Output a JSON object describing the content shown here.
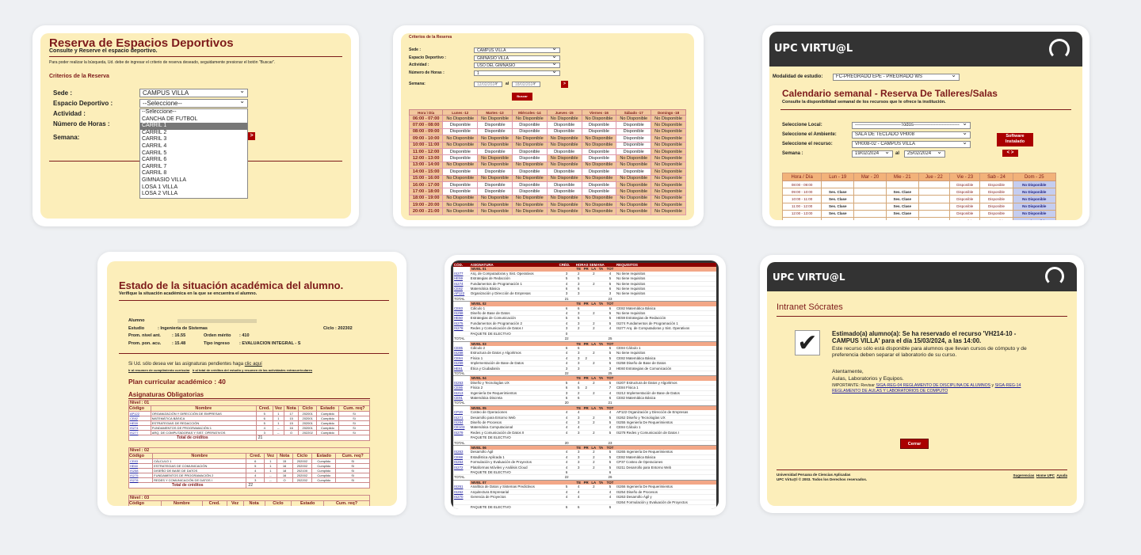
{
  "c1": {
    "title": "Reserva de Espacios Deportivos",
    "subtitle": "Consulte y Reserve el espacio deportivo.",
    "help": "Para poder realizar la búsqueda, Ud. debe de ingresar el criterio de reserva deseado, seguidamente presionar el botón \"Buscar\".",
    "section": "Criterios de la Reserva",
    "l_sede": "Sede :",
    "v_sede": "CAMPUS VILLA",
    "l_esp": "Espacio Deportivo :",
    "v_esp": "--Seleccione--",
    "l_act": "Actividad :",
    "l_horas": "Número de Horas :",
    "l_sem": "Semana:",
    "options": [
      "--Seleccione--",
      "CANCHA DE FUTBOL",
      "CARRIL 1",
      "CARRIL 2",
      "CARRIL 3",
      "CARRIL 4",
      "CARRIL 5",
      "CARRIL 6",
      "CARRIL 7",
      "CARRIL 8",
      "GIMNASIO VILLA",
      "LOSA 1 VILLA",
      "LOSA 2 VILLA"
    ],
    "selected": "CARRIL 1"
  },
  "c2": {
    "section": "Criterios de la Reserva",
    "l_sede": "Sede :",
    "v_sede": "CAMPUS VILLA",
    "l_esp": "Espacio Deportivo :",
    "v_esp": "GIMNASIO VILLA",
    "l_act": "Actividad :",
    "v_act": "USO DEL GIMNASIO",
    "l_horas": "Número de Horas :",
    "v_horas": "1",
    "l_sem": "Semana:",
    "from": "12/02/2024",
    "al": "al",
    "to": "18/02/2024",
    "search": "Buscar",
    "go": ">",
    "headers": [
      "Hora \\ Día",
      "Lunes -12",
      "Martes -13",
      "Miércoles -14",
      "Jueves -15",
      "Viernes -16",
      "Sábado -17",
      "Domingo -18"
    ],
    "rows": [
      [
        "06:00 - 07:00",
        "No Disponible",
        "No Disponible",
        "No Disponible",
        "No Disponible",
        "No Disponible",
        "No Disponible",
        "No Disponible"
      ],
      [
        "07:00 - 08:00",
        "Disponible",
        "Disponible",
        "Disponible",
        "Disponible",
        "Disponible",
        "Disponible",
        "No Disponible"
      ],
      [
        "08:00 - 09:00",
        "Disponible",
        "Disponible",
        "Disponible",
        "Disponible",
        "Disponible",
        "Disponible",
        "No Disponible"
      ],
      [
        "09:00 - 10:00",
        "No Disponible",
        "No Disponible",
        "No Disponible",
        "No Disponible",
        "No Disponible",
        "Disponible",
        "No Disponible"
      ],
      [
        "10:00 - 11:00",
        "No Disponible",
        "No Disponible",
        "No Disponible",
        "No Disponible",
        "No Disponible",
        "Disponible",
        "No Disponible"
      ],
      [
        "11:00 - 12:00",
        "Disponible",
        "Disponible",
        "Disponible",
        "Disponible",
        "Disponible",
        "Disponible",
        "No Disponible"
      ],
      [
        "12:00 - 13:00",
        "Disponible",
        "No Disponible",
        "Disponible",
        "No Disponible",
        "Disponible",
        "No Disponible",
        "No Disponible"
      ],
      [
        "13:00 - 14:00",
        "No Disponible",
        "No Disponible",
        "No Disponible",
        "No Disponible",
        "No Disponible",
        "No Disponible",
        "No Disponible"
      ],
      [
        "14:00 - 15:00",
        "Disponible",
        "Disponible",
        "Disponible",
        "Disponible",
        "Disponible",
        "Disponible",
        "No Disponible"
      ],
      [
        "15:00 - 16:00",
        "No Disponible",
        "No Disponible",
        "No Disponible",
        "No Disponible",
        "No Disponible",
        "No Disponible",
        "No Disponible"
      ],
      [
        "16:00 - 17:00",
        "Disponible",
        "Disponible",
        "Disponible",
        "Disponible",
        "Disponible",
        "No Disponible",
        "No Disponible"
      ],
      [
        "17:00 - 18:00",
        "Disponible",
        "Disponible",
        "Disponible",
        "Disponible",
        "Disponible",
        "No Disponible",
        "No Disponible"
      ],
      [
        "18:00 - 19:00",
        "No Disponible",
        "No Disponible",
        "No Disponible",
        "No Disponible",
        "No Disponible",
        "No Disponible",
        "No Disponible"
      ],
      [
        "19:00 - 20:00",
        "No Disponible",
        "No Disponible",
        "No Disponible",
        "No Disponible",
        "No Disponible",
        "No Disponible",
        "No Disponible"
      ],
      [
        "20:00 - 21:00",
        "No Disponible",
        "No Disponible",
        "No Disponible",
        "No Disponible",
        "No Disponible",
        "No Disponible",
        "No Disponible"
      ]
    ]
  },
  "c3": {
    "brand": "UPC VIRTU@L",
    "l_mod": "Modalidad de estudio:",
    "v_mod": "FC-PREGRADO EPE - PREGRADO WS",
    "title": "Calendario semanal - Reserva De Talleres/Salas",
    "subtitle": "Consulte la disponibilidad semanal de los recursos que le ofrece la institución.",
    "l_local": "Seleccione Local:",
    "v_local": "-----------------------------Todos-----------------------------",
    "l_amb": "Seleccione el Ambiente:",
    "v_amb": "SALA DE TECLADO VH008",
    "l_rec": "Seleccione el recurso:",
    "v_rec": "VH008-02 - CAMPUS VILLA",
    "l_sem": "Semana :",
    "from": "19/02/2024",
    "al": "al",
    "to": "25/02/2024",
    "btn": "Software Instalado",
    "nav": "< >",
    "headers": [
      "Hora / Día",
      "Lun - 19",
      "Mar - 20",
      "Mie - 21",
      "Jue - 22",
      "Vie - 23",
      "Sab - 24",
      "Dom - 25"
    ],
    "rows": [
      [
        "08:00 - 09:00",
        "",
        "",
        "",
        "",
        "Disponible",
        "Disponible",
        "No Disponible"
      ],
      [
        "09:00 - 10:00",
        "Ses. Clase",
        "",
        "Ses. Clase",
        "",
        "Disponible",
        "Disponible",
        "No Disponible"
      ],
      [
        "10:00 - 11:00",
        "Ses. Clase",
        "",
        "Ses. Clase",
        "",
        "Disponible",
        "Disponible",
        "No Disponible"
      ],
      [
        "11:00 - 12:00",
        "Ses. Clase",
        "",
        "Ses. Clase",
        "",
        "Disponible",
        "Disponible",
        "No Disponible"
      ],
      [
        "12:00 - 13:00",
        "Ses. Clase",
        "",
        "Ses. Clase",
        "",
        "Disponible",
        "Disponible",
        "No Disponible"
      ],
      [
        "13:00 - 14:00",
        "",
        "",
        "",
        "",
        "Disponible",
        "Disponible",
        "No Disponible"
      ]
    ]
  },
  "c4": {
    "title": "Estado de la situación académica del alumno.",
    "subtitle": "Verifique la situación académica en la que se encuentra el alumno.",
    "l_alumno": "Alumno",
    "l_estudio": "Estudio",
    "v_estudio": ": Ingeniería de Sistemas",
    "l_ciclo": "Ciclo : 202302",
    "l_pna": "Prom. nivel ant.",
    "v_pna": ": 16.55",
    "l_om": "Orden mérito",
    "v_om": ": 410",
    "l_ppa": "Prom. pon. acu.",
    "v_ppa": ": 15.48",
    "l_ti": "Tipo ingreso",
    "v_ti": ": EVALUACION INTEGRAL - S",
    "note": "Si Ud. sólo desea ver las asignaturas pendientes haga",
    "clic": "clic aquí",
    "link1": "Ir al resumen de cumplimiento curricular",
    "link2": "Ir al total de créditos del estudio y resumen de las actividades extracurriculares",
    "plan": "Plan curricular académico : 40",
    "obl": "Asignaturas Obligatorias",
    "headers": [
      "Código",
      "Nombre",
      "Cred.",
      "Vez",
      "Nota",
      "Ciclo",
      "Estado",
      "Cum. req?"
    ],
    "total": "Total de créditos",
    "niveles": [
      {
        "name": "Nivel : 01",
        "total": "21",
        "rows": [
          [
            "AP122",
            "ORGANIZACIÓN Y DIRECCIÓN DE EMPRESAS",
            "5",
            "1",
            "17",
            "202001",
            "Cumplido",
            "Si"
          ],
          [
            "CE82",
            "MATEMÁTICA BÁSICA",
            "6",
            "1",
            "15",
            "202001",
            "Cumplido",
            "Si"
          ],
          [
            "HE59",
            "ESTRATEGIAS DE REDACCIÓN",
            "5",
            "1",
            "15",
            "202001",
            "Cumplido",
            "Si"
          ],
          [
            "IS274",
            "FUNDAMENTOS DE PROGRAMACIÓN 1",
            "4",
            "--",
            "16",
            "202001",
            "Cumplido",
            "Si"
          ],
          [
            "IS277",
            "ARQ. DE COMPUTADORAS Y SIST. OPERATIVOS",
            "3",
            "--",
            "O",
            "202202",
            "Cumplido",
            "Si"
          ]
        ]
      },
      {
        "name": "Nivel : 02",
        "total": "22",
        "rows": [
          [
            "CE83",
            "CÁLCULO 1",
            "6",
            "1",
            "15",
            "202002",
            "Cumplido",
            "Si"
          ],
          [
            "HE60",
            "ESTRATEGIAS DE COMUNICACIÓN",
            "5",
            "1",
            "16",
            "202002",
            "Cumplido",
            "Si"
          ],
          [
            "IS258",
            "DISEÑO DE BASE DE DATOS",
            "4",
            "1",
            "18",
            "202100",
            "Cumplido",
            "Si"
          ],
          [
            "IS275",
            "FUNDAMENTOS DE PROGRAMACIÓN 2",
            "4",
            "--",
            "16",
            "202002",
            "Cumplido",
            "Si"
          ],
          [
            "IS278",
            "REDES Y COMUNICACIÓN DE DATOS I",
            "3",
            "--",
            "O",
            "202202",
            "Cumplido",
            "Si"
          ]
        ]
      },
      {
        "name": "Nivel : 03",
        "total": "",
        "rows": [
          [
            "CE85",
            "CÁLCULO 2",
            "6",
            "1",
            "13",
            "202101",
            "Cumplido",
            "Si"
          ]
        ]
      }
    ]
  },
  "c5": {
    "headers": [
      "CÓD.",
      "ASIGNATURA",
      "CRÉD.",
      "HORAS SEMANA",
      "REQUISITOS"
    ],
    "sub": [
      "TE",
      "PR",
      "LA",
      "TA",
      "TOT"
    ],
    "total_label": "TOTAL",
    "niveles": [
      {
        "name": "NIVEL 01",
        "total": "21",
        "tot": "23",
        "rows": [
          [
            "IS277",
            "Arq. de Computadoras y Sist. Operativos",
            "3",
            "2",
            "",
            "2",
            "",
            "4",
            "No tiene requisitos"
          ],
          [
            "HE59",
            "Estrategias de Redacción",
            "5",
            "5",
            "",
            "",
            "",
            "5",
            "No tiene requisitos"
          ],
          [
            "IS274",
            "Fundamentos de Programación 1",
            "4",
            "3",
            "",
            "2",
            "",
            "5",
            "No tiene requisitos"
          ],
          [
            "CE82",
            "Matemática Básica",
            "6",
            "6",
            "",
            "",
            "",
            "6",
            "No tiene requisitos"
          ],
          [
            "AP122",
            "Organización y Dirección de Empresas",
            "3",
            "3",
            "",
            "",
            "",
            "3",
            "No tiene requisitos"
          ]
        ]
      },
      {
        "name": "NIVEL 02",
        "total": "22",
        "tot": "25",
        "rows": [
          [
            "CE83",
            "Cálculo 1",
            "6",
            "6",
            "",
            "",
            "",
            "6",
            "CE82 Matemática Básica"
          ],
          [
            "IS258",
            "Diseño de Base de Datos",
            "4",
            "3",
            "",
            "2",
            "",
            "5",
            "No tiene requisitos"
          ],
          [
            "HE60",
            "Estrategias de Comunicación",
            "5",
            "5",
            "",
            "",
            "",
            "5",
            "HE59 Estrategias de Redacción"
          ],
          [
            "IS275",
            "Fundamentos de Programación 2",
            "4",
            "3",
            "",
            "2",
            "",
            "5",
            "IS274 Fundamentos de Programación 1"
          ],
          [
            "IS278",
            "Redes y Comunicación de Datos I",
            "3",
            "2",
            "",
            "2",
            "",
            "4",
            "IS277 Arq. de Computadoras y Sist. Operativos"
          ],
          [
            "",
            "PAQUETE DE ELECTIVO",
            "0",
            "",
            "",
            "",
            "",
            "",
            ""
          ]
        ]
      },
      {
        "name": "NIVEL 03",
        "total": "22",
        "tot": "25",
        "rows": [
          [
            "CE85",
            "Cálculo 2",
            "6",
            "6",
            "",
            "",
            "",
            "6",
            "CE84 Cálculo 1"
          ],
          [
            "IS268",
            "Estructura de Datos y Algoritmos",
            "4",
            "3",
            "",
            "2",
            "",
            "5",
            "No tiene requisitos"
          ],
          [
            "CE84",
            "Física 1",
            "4",
            "3",
            "2",
            "",
            "",
            "5",
            "CE82 Matemática Básica"
          ],
          [
            "IS259",
            "Implementación de Base de Datos",
            "4",
            "3",
            "",
            "2",
            "",
            "5",
            "IS258 Diseño de Base de Datos"
          ],
          [
            "HE61",
            "Ética y Ciudadanía",
            "3",
            "3",
            "",
            "",
            "",
            "3",
            "HE60 Estrategias de Comunicación"
          ]
        ]
      },
      {
        "name": "NIVEL 04",
        "total": "20",
        "tot": "21",
        "rows": [
          [
            "IS263",
            "Diseño y Tecnologías UX",
            "5",
            "4",
            "",
            "2",
            "",
            "5",
            "IS207 Estructura de Datos y Algoritmos"
          ],
          [
            "CE86",
            "Física 2",
            "6",
            "5",
            "2",
            "",
            "",
            "7",
            "CE84 Física 1"
          ],
          [
            "IS213",
            "Ingeniería De Requerimientos",
            "3",
            "2",
            "",
            "2",
            "",
            "4",
            "IS212 Implementación de Base de Datos"
          ],
          [
            "CE91",
            "Matemática Discreta",
            "6",
            "6",
            "",
            "",
            "",
            "6",
            "CE82 Matemática Básica"
          ]
        ]
      },
      {
        "name": "NIVEL 05",
        "total": "20",
        "tot": "23",
        "rows": [
          [
            "CP20",
            "Costeo de Operaciones",
            "4",
            "4",
            "",
            "",
            "",
            "4",
            "AP122 Organización y Dirección de Empresas"
          ],
          [
            "IS271",
            "Desarrollo para Entorno Web",
            "4",
            "3",
            "",
            "2",
            "",
            "5",
            "IS262 Diseño y Tecnologías UX"
          ],
          [
            "IS264",
            "Diseño de Procesos",
            "4",
            "3",
            "",
            "2",
            "",
            "5",
            "IS255 Ingeniería De Requerimientos"
          ],
          [
            "CE103",
            "Matemática Computacional",
            "4",
            "4",
            "",
            "",
            "",
            "4",
            "CE84 Cálculo 1"
          ],
          [
            "IS279",
            "Redes y Comunicación de Datos II",
            "4",
            "3",
            "",
            "2",
            "",
            "5",
            "IS278 Redes y Comunicación de Datos I"
          ],
          [
            "",
            "PAQUETE DE ELECTIVO",
            "",
            "",
            "",
            "",
            "",
            "",
            ""
          ]
        ]
      },
      {
        "name": "NIVEL 06",
        "total": "22",
        "tot": "26",
        "rows": [
          [
            "IS263",
            "Desarrollo Ágil",
            "4",
            "3",
            "",
            "2",
            "",
            "5",
            "IS265 Ingeniería De Requerimientos"
          ],
          [
            "CE88",
            "Estadística Aplicada 1",
            "4",
            "3",
            "",
            "2",
            "",
            "5",
            "CE82 Matemática Básica"
          ],
          [
            "IS264",
            "Formulación y Evaluación de Proyectos",
            "4",
            "3",
            "",
            "2",
            "",
            "5",
            "CP37 Costeo de Operaciones"
          ],
          [
            "IS272",
            "Plataformas Móviles y Análisis Cloud",
            "4",
            "3",
            "",
            "2",
            "",
            "5",
            "IS211 Desarrollo para Entorno Web"
          ],
          [
            "",
            "PAQUETE DE ELECTIVO",
            "6",
            "",
            "",
            "",
            "",
            "6",
            ""
          ]
        ]
      },
      {
        "name": "NIVEL 07",
        "total": "",
        "tot": "",
        "rows": [
          [
            "IS261",
            "Analítica de Datos y Sistemas Predictivos",
            "5",
            "4",
            "",
            "2",
            "",
            "5",
            "IS266 Ingeniería De Requerimientos"
          ],
          [
            "IS262",
            "Arquitectura Empresarial",
            "4",
            "4",
            "",
            "",
            "",
            "4",
            "IS254 Diseño de Procesos"
          ],
          [
            "IS270",
            "Gerencia de Proyectos",
            "4",
            "4",
            "",
            "",
            "",
            "4",
            "IS263 Desarrollo Ágil y"
          ],
          [
            "",
            "",
            "",
            "",
            "",
            "",
            "",
            "",
            "IS264 Formulación y Evaluación de Proyectos"
          ],
          [
            "",
            "PAQUETE DE ELECTIVO",
            "6",
            "6",
            "",
            "",
            "",
            "6",
            ""
          ]
        ]
      }
    ]
  },
  "c6": {
    "brand": "UPC VIRTU@L",
    "title": "Intranet Sócrates",
    "msg": "Estimado(a) alumno(a): Se ha reservado el recurso 'VH214-10 - CAMPUS VILLA' para el día 15/03/2024, a las 14:00.",
    "msg2": "Este recurso sólo está disponible para alumnos que llevan cursos de cómputo y de preferencia deben separar el laboratorio de su curso.",
    "att": "Atentamente,",
    "att2": "Aulas, Laboratorios y Equipos.",
    "imp": "IMPORTANTE: Revisar",
    "imp_l1": "SIGA-REG-04 REGLAMENTO DE DISCIPLINA DE ALUMNOS",
    "imp_y": "y",
    "imp_l2": "SIGA-REG-14 REGLAMENTO DE AULAS Y LABORATORIOS DE COMPUTO",
    "close": "Cerrar",
    "foot1": "Universidad Peruana de Ciencias Aplicadas",
    "foot2": "UPC Virtu@l © 2003. Todos los Derechos reservados.",
    "flinks": [
      "Sugerencias",
      "Home UPC",
      "Ayuda"
    ]
  }
}
